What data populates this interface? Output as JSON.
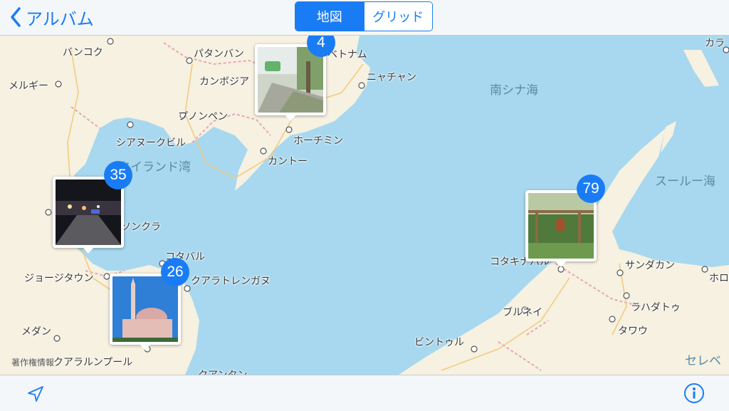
{
  "nav": {
    "back_label": "アルバム",
    "segments": [
      "地図",
      "グリッド"
    ],
    "selected_segment": "地図"
  },
  "map": {
    "places": [
      "バンコク",
      "パタンバン",
      "メルギー",
      "カンボジア",
      "ニャチャン",
      "プノンペン",
      "シアヌークビル",
      "ホーチミン",
      "カントー",
      "ソンクラ",
      "コタバル",
      "ジョージタウン",
      "クアラトレンガヌ",
      "メダン",
      "クアラルンプール",
      "クアンタン",
      "コタキナバル",
      "サンダカン",
      "ラハダトゥ",
      "ブルネイ",
      "タワウ",
      "ビントゥル",
      "ホロ",
      "カラ",
      "ベトナム"
    ],
    "seas": [
      "南シナ海",
      "タイランド湾",
      "スールー海",
      "セレベ"
    ],
    "legal": "著作権情報"
  },
  "clusters": [
    {
      "count": "4",
      "photo": "street-scene"
    },
    {
      "count": "35",
      "photo": "night-market"
    },
    {
      "count": "26",
      "photo": "mosque"
    },
    {
      "count": "79",
      "photo": "orangutan-platform"
    }
  ],
  "toolbar": {
    "location_icon": "location-arrow-icon",
    "info_icon": "info-icon"
  },
  "colors": {
    "accent": "#1a7cf5",
    "water": "#a7d8ef",
    "land": "#f6f1e1",
    "border": "#e8a7b6"
  }
}
